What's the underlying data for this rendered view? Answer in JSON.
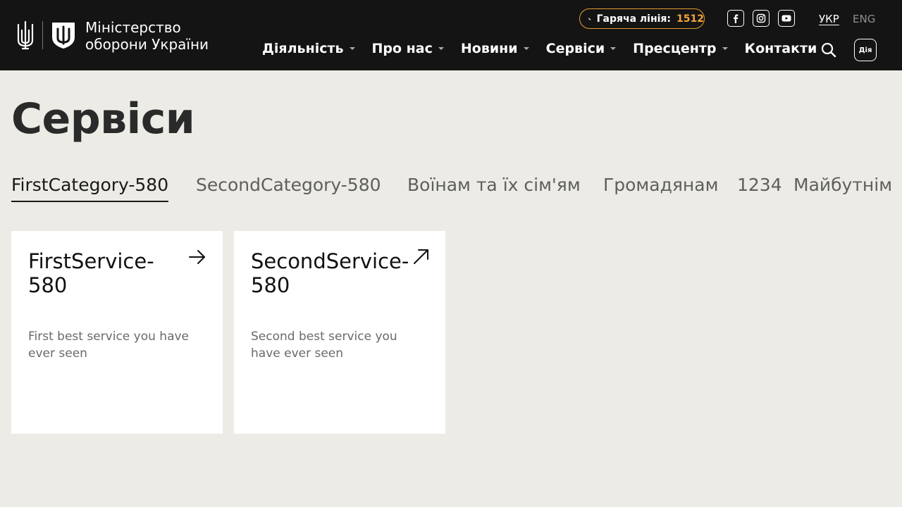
{
  "header": {
    "ministry_line1": "Міністерство",
    "ministry_line2": "оборони України",
    "hotline_label": "Гаряча лінія:",
    "hotline_number": "1512",
    "lang_active": "УКР",
    "lang_other": "ENG",
    "diia_label": "Дія",
    "nav": [
      {
        "label": "Діяльність"
      },
      {
        "label": "Про нас"
      },
      {
        "label": "Новини"
      },
      {
        "label": "Сервіси"
      },
      {
        "label": "Пресцентр"
      },
      {
        "label": "Контакти"
      }
    ],
    "social_icons": [
      "facebook-icon",
      "instagram-icon",
      "youtube-icon"
    ]
  },
  "page": {
    "title": "Сервіси"
  },
  "tabs": [
    {
      "label": "FirstCategory-580"
    },
    {
      "label": "SecondCategory-580"
    },
    {
      "label": "Воїнам та їх сім'ям"
    },
    {
      "label": "Громадянам"
    },
    {
      "label": "1234"
    },
    {
      "label": "Майбутнім"
    }
  ],
  "cards": [
    {
      "title": "FirstService-580",
      "description": "First best service you have ever seen",
      "icon": "arrow-right-icon"
    },
    {
      "title": "SecondService-580",
      "description": "Second best service you have ever seen",
      "icon": "arrow-up-right-icon"
    }
  ],
  "colors": {
    "header_bg": "#141414",
    "page_bg": "#ecebe6",
    "accent": "#f2a43a"
  }
}
